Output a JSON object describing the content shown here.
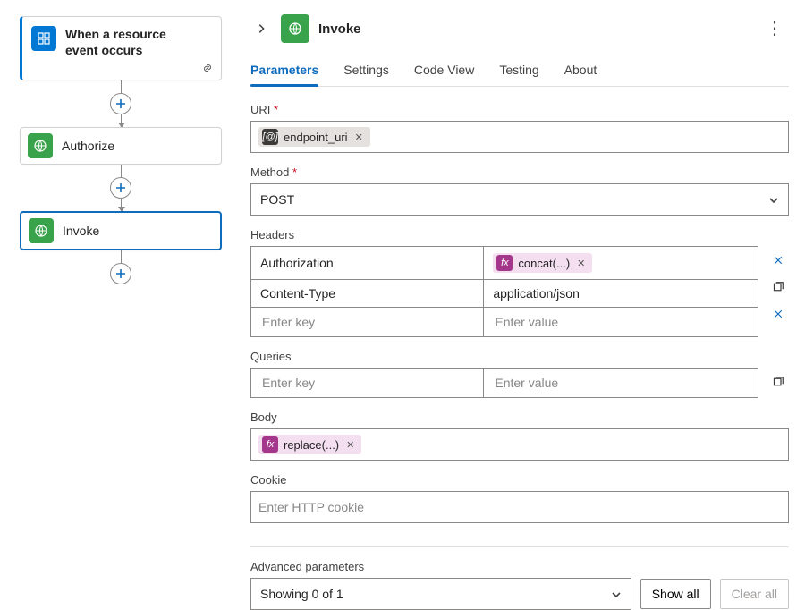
{
  "flow": {
    "trigger": {
      "title": "When a resource event occurs"
    },
    "actions": [
      {
        "title": "Authorize"
      },
      {
        "title": "Invoke"
      }
    ]
  },
  "panel": {
    "title": "Invoke",
    "tabs": [
      "Parameters",
      "Settings",
      "Code View",
      "Testing",
      "About"
    ],
    "active_tab": "Parameters"
  },
  "params": {
    "uri_label": "URI",
    "uri_token": "endpoint_uri",
    "method_label": "Method",
    "method_value": "POST",
    "headers_label": "Headers",
    "headers": [
      {
        "key": "Authorization",
        "value_token": "concat(...)",
        "is_fx": true
      },
      {
        "key": "Content-Type",
        "value_text": "application/json",
        "is_fx": false
      }
    ],
    "header_key_placeholder": "Enter key",
    "header_value_placeholder": "Enter value",
    "queries_label": "Queries",
    "queries_key_placeholder": "Enter key",
    "queries_value_placeholder": "Enter value",
    "body_label": "Body",
    "body_token": "replace(...)",
    "cookie_label": "Cookie",
    "cookie_placeholder": "Enter HTTP cookie",
    "advanced_label": "Advanced parameters",
    "advanced_value": "Showing 0 of 1",
    "show_all": "Show all",
    "clear_all": "Clear all"
  }
}
